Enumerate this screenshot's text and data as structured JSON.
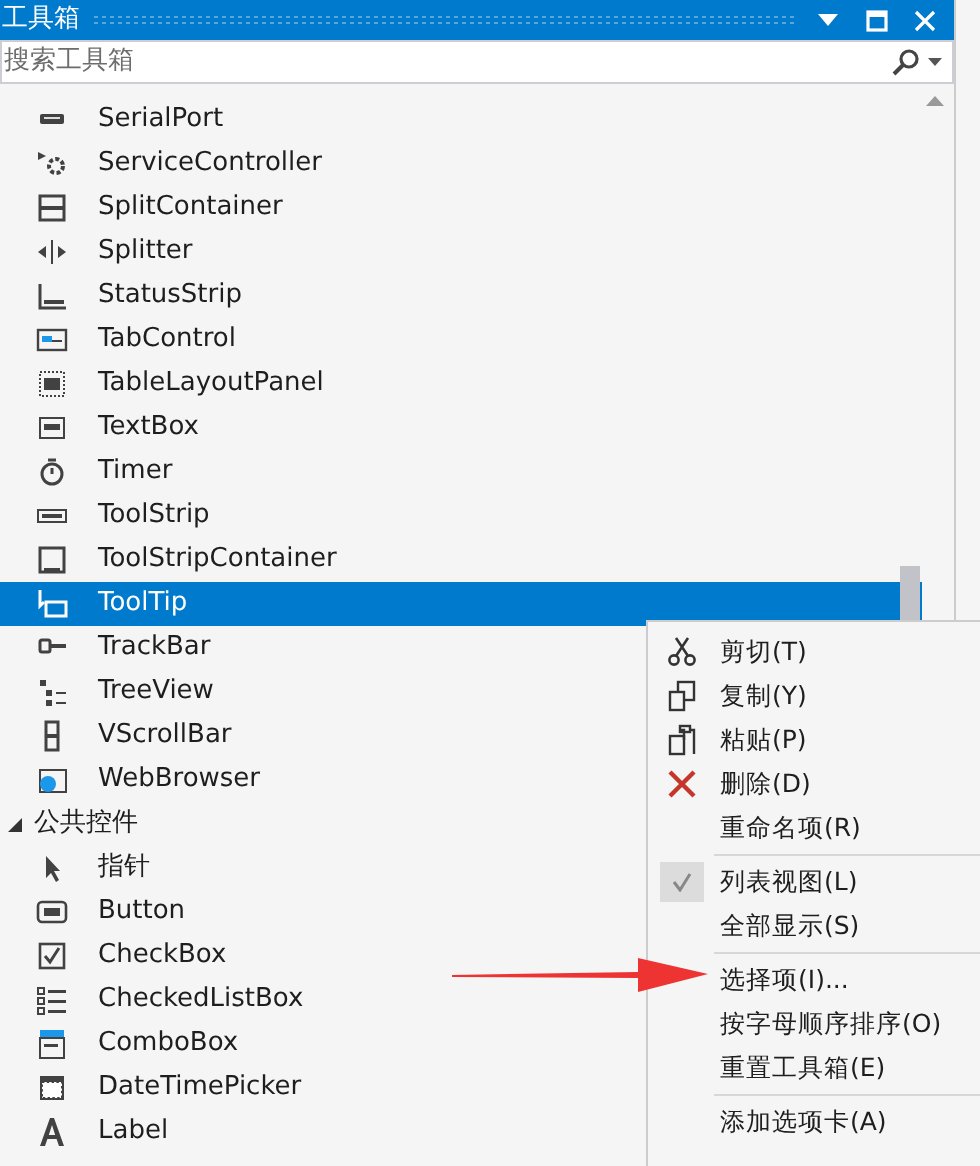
{
  "window": {
    "title": "工具箱"
  },
  "search": {
    "placeholder": "搜索工具箱"
  },
  "items": [
    {
      "kind": "item",
      "label": "SerialPort",
      "selected": false
    },
    {
      "kind": "item",
      "label": "ServiceController",
      "selected": false
    },
    {
      "kind": "item",
      "label": "SplitContainer",
      "selected": false
    },
    {
      "kind": "item",
      "label": "Splitter",
      "selected": false
    },
    {
      "kind": "item",
      "label": "StatusStrip",
      "selected": false
    },
    {
      "kind": "item",
      "label": "TabControl",
      "selected": false
    },
    {
      "kind": "item",
      "label": "TableLayoutPanel",
      "selected": false
    },
    {
      "kind": "item",
      "label": "TextBox",
      "selected": false
    },
    {
      "kind": "item",
      "label": "Timer",
      "selected": false
    },
    {
      "kind": "item",
      "label": "ToolStrip",
      "selected": false
    },
    {
      "kind": "item",
      "label": "ToolStripContainer",
      "selected": false
    },
    {
      "kind": "item",
      "label": "ToolTip",
      "selected": true
    },
    {
      "kind": "item",
      "label": "TrackBar",
      "selected": false
    },
    {
      "kind": "item",
      "label": "TreeView",
      "selected": false
    },
    {
      "kind": "item",
      "label": "VScrollBar",
      "selected": false
    },
    {
      "kind": "item",
      "label": "WebBrowser",
      "selected": false
    },
    {
      "kind": "category",
      "label": "公共控件",
      "expanded": true
    },
    {
      "kind": "item",
      "label": "指针",
      "selected": false
    },
    {
      "kind": "item",
      "label": "Button",
      "selected": false
    },
    {
      "kind": "item",
      "label": "CheckBox",
      "selected": false
    },
    {
      "kind": "item",
      "label": "CheckedListBox",
      "selected": false
    },
    {
      "kind": "item",
      "label": "ComboBox",
      "selected": false
    },
    {
      "kind": "item",
      "label": "DateTimePicker",
      "selected": false
    },
    {
      "kind": "item",
      "label": "Label",
      "selected": false
    }
  ],
  "context_menu": [
    {
      "kind": "item",
      "label": "剪切(T)",
      "checked": false
    },
    {
      "kind": "item",
      "label": "复制(Y)",
      "checked": false
    },
    {
      "kind": "item",
      "label": "粘贴(P)",
      "checked": false
    },
    {
      "kind": "item",
      "label": "删除(D)",
      "checked": false
    },
    {
      "kind": "item",
      "label": "重命名项(R)",
      "checked": false
    },
    {
      "kind": "separator"
    },
    {
      "kind": "item",
      "label": "列表视图(L)",
      "checked": true
    },
    {
      "kind": "item",
      "label": "全部显示(S)",
      "checked": false
    },
    {
      "kind": "separator"
    },
    {
      "kind": "item",
      "label": "选择项(I)...",
      "checked": false
    },
    {
      "kind": "item",
      "label": "按字母顺序排序(O)",
      "checked": false
    },
    {
      "kind": "item",
      "label": "重置工具箱(E)",
      "checked": false
    },
    {
      "kind": "separator"
    },
    {
      "kind": "item",
      "label": "添加选项卡(A)",
      "checked": false
    }
  ]
}
